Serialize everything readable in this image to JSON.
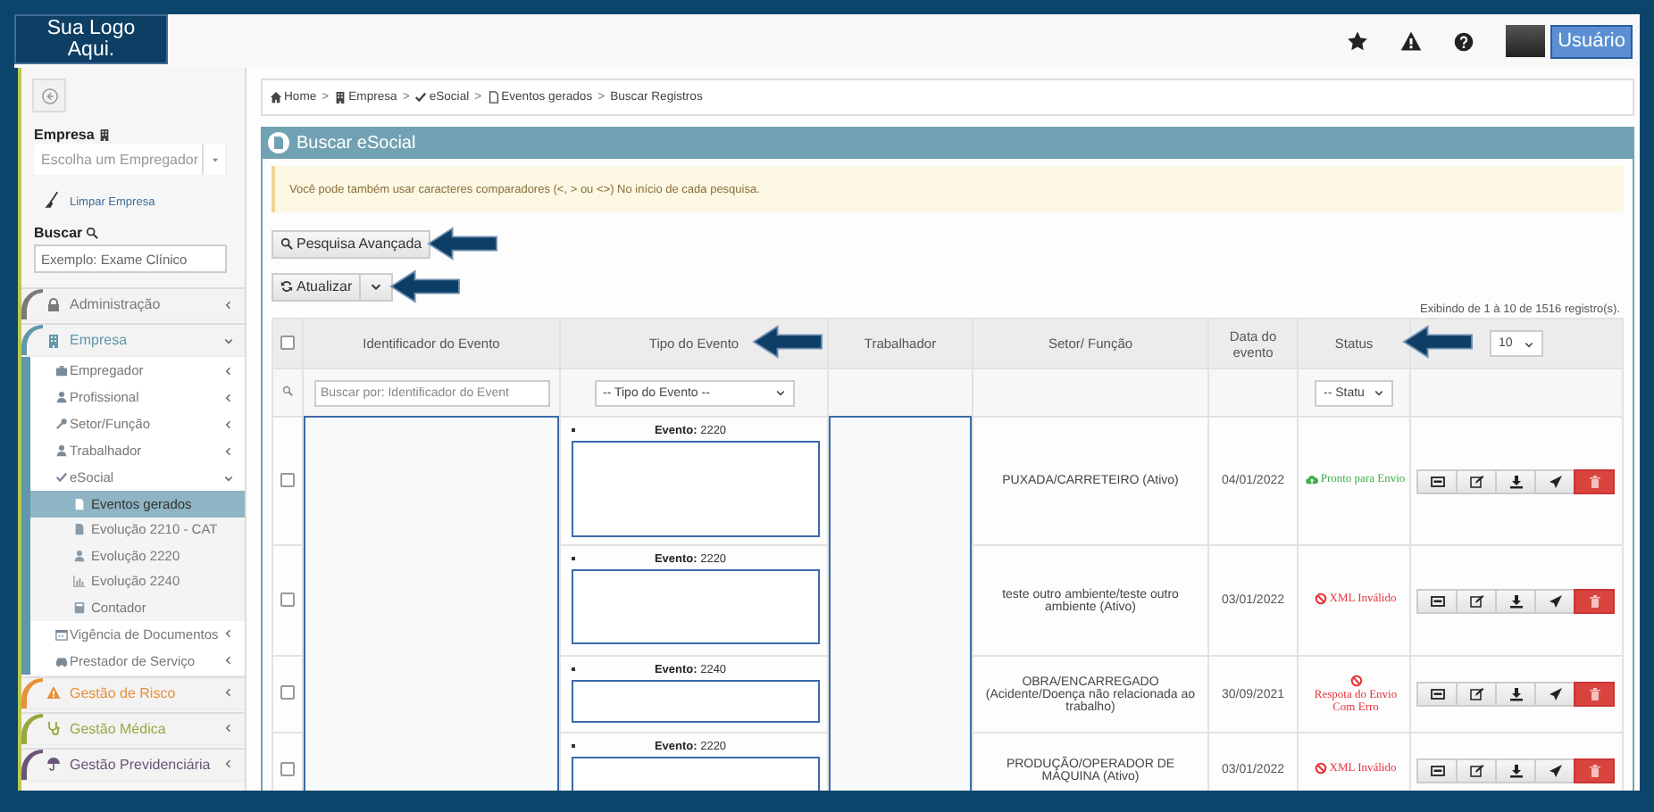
{
  "logo": {
    "text": "Sua Logo Aqui."
  },
  "topbar": {
    "user_button": "Usuário"
  },
  "sidebar": {
    "empresa_label": "Empresa",
    "empresa_select": {
      "placeholder": "Escolha um Empregador"
    },
    "clear_link": "Limpar Empresa",
    "search_label": "Buscar",
    "search_field": {
      "placeholder": "Exemplo: Exame Clínico"
    },
    "items": [
      {
        "label": "Administração",
        "color": "#7a7a7a",
        "expanded": false
      },
      {
        "label": "Empresa",
        "color": "#5f97ab",
        "expanded": true,
        "children": [
          {
            "label": "Empregador",
            "expanded": false
          },
          {
            "label": "Profissional",
            "expanded": false
          },
          {
            "label": "Setor/Função",
            "expanded": false
          },
          {
            "label": "Trabalhador",
            "expanded": false
          },
          {
            "label": "eSocial",
            "expanded": true,
            "children": [
              {
                "label": "Eventos gerados",
                "selected": true
              },
              {
                "label": "Evolução 2210 - CAT",
                "selected": false
              },
              {
                "label": "Evolução 2220",
                "selected": false
              },
              {
                "label": "Evolução 2240",
                "selected": false
              },
              {
                "label": "Contador",
                "selected": false
              }
            ]
          },
          {
            "label": "Vigência de Documentos",
            "expanded": false
          },
          {
            "label": "Prestador de Serviço",
            "expanded": false
          }
        ]
      },
      {
        "label": "Gestão de Risco",
        "color": "#e8903a",
        "expanded": false
      },
      {
        "label": "Gestão Médica",
        "color": "#96a83f",
        "expanded": false
      },
      {
        "label": "Gestão Previdenciária",
        "color": "#6a5478",
        "expanded": false
      }
    ]
  },
  "breadcrumb": [
    {
      "label": "Home"
    },
    {
      "separator": ">",
      "label": "Empresa"
    },
    {
      "separator": ">",
      "label": "eSocial"
    },
    {
      "separator": ">",
      "label": "Eventos gerados"
    },
    {
      "separator": ">",
      "label": "Buscar Registros"
    }
  ],
  "panel": {
    "title": "Buscar eSocial",
    "alert": "Você pode também usar caracteres comparadores (<, > ou <>) No início de cada pesquisa.",
    "advanced_search_button": "Pesquisa Avançada",
    "refresh_button": "Atualizar",
    "records_info": "Exibindo de 1 à 10 de 1516 registro(s).",
    "table": {
      "select_all_checked": false,
      "columns": [
        "Identificador do Evento",
        "Tipo do Evento",
        "Trabalhador",
        "Setor/ Função",
        "Data do evento",
        "Status"
      ],
      "page_size": "10",
      "filters": {
        "identifier_placeholder": "Buscar por: Identificador do Event",
        "event_type": "-- Tipo do Evento --",
        "status": "-- Statu"
      },
      "rows": [
        {
          "checked": false,
          "event": "**Evento:** 2220",
          "sector": "PUXADA/CARRETEIRO (Ativo)",
          "date": "04/01/2022",
          "status": {
            "kind": "ready",
            "text": "Pronto para Envio"
          }
        },
        {
          "checked": false,
          "event": "**Evento:** 2220",
          "sector": "teste outro ambiente/teste outro ambiente (Ativo)",
          "date": "03/01/2022",
          "status": {
            "kind": "error",
            "text": "XML Inválido"
          }
        },
        {
          "checked": false,
          "event": "**Evento:** 2240",
          "sector": "OBRA/ENCARREGADO (Acidente/Doença não relacionada ao trabalho)",
          "date": "30/09/2021",
          "status": {
            "kind": "error",
            "text": "Respota do Envio Com Erro"
          }
        },
        {
          "checked": false,
          "event": "**Evento:** 2220",
          "sector": "PRODUÇÃO/OPERADOR DE MÁQUINA (Ativo)",
          "date": "03/01/2022",
          "status": {
            "kind": "error",
            "text": "XML Inválido"
          }
        }
      ]
    }
  }
}
